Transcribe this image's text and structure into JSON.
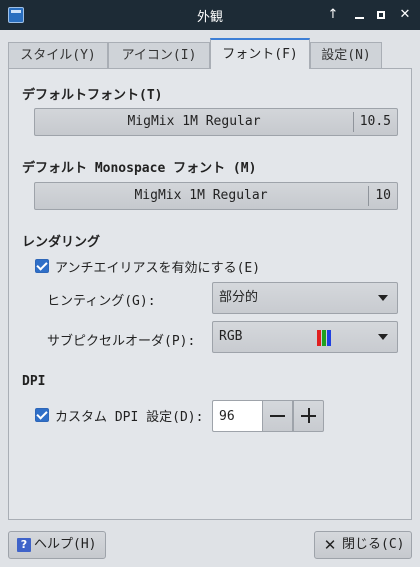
{
  "window": {
    "title": "外観"
  },
  "tabs": [
    {
      "label": "スタイル(Y)"
    },
    {
      "label": "アイコン(I)"
    },
    {
      "label": "フォント(F)"
    },
    {
      "label": "設定(N)"
    }
  ],
  "default_font": {
    "title": "デフォルトフォント(T)",
    "name": "MigMix 1M Regular",
    "size": "10.5"
  },
  "monospace_font": {
    "title": "デフォルト Monospace フォント (M)",
    "name": "MigMix 1M Regular",
    "size": "10"
  },
  "rendering": {
    "title": "レンダリング",
    "antialias_label": "アンチエイリアスを有効にする(E)",
    "antialias_checked": true,
    "hinting_label": "ヒンティング(G):",
    "hinting_value": "部分的",
    "subpixel_label": "サブピクセルオーダ(P):",
    "subpixel_value": "RGB",
    "subpixel_icon": "rgb-stripes-icon"
  },
  "dpi": {
    "title": "DPI",
    "custom_label": "カスタム DPI 設定(D):",
    "custom_checked": true,
    "value": "96"
  },
  "footer": {
    "help_label": "ヘルプ(H)",
    "close_label": "閉じる(C)"
  },
  "colors": {
    "titlebar": "#1d2b36",
    "accent": "#3d7fd6",
    "checkbox": "#2f6fc8"
  }
}
